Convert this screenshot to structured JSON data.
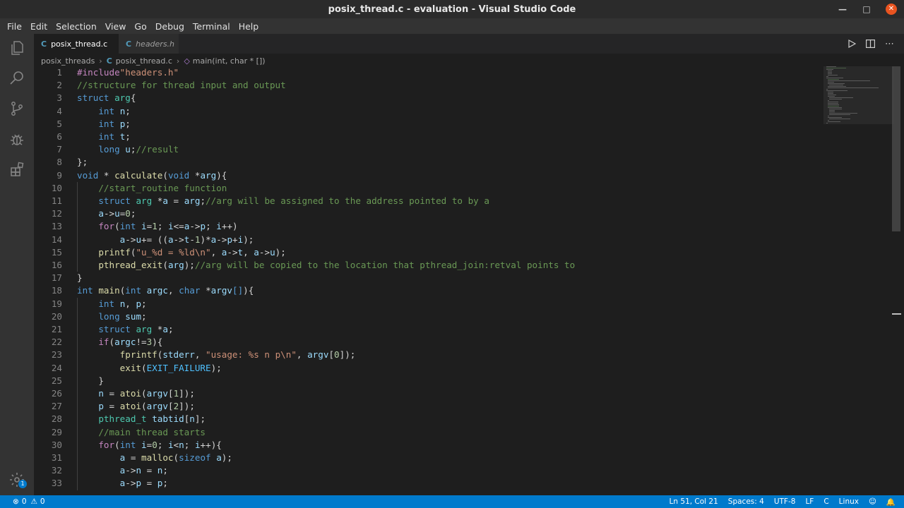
{
  "window": {
    "title": "posix_thread.c - evaluation - Visual Studio Code"
  },
  "menu": [
    "File",
    "Edit",
    "Selection",
    "View",
    "Go",
    "Debug",
    "Terminal",
    "Help"
  ],
  "tabs": [
    {
      "icon": "C",
      "label": "posix_thread.c",
      "active": true
    },
    {
      "icon": "C",
      "label": "headers.h",
      "active": false
    }
  ],
  "breadcrumb": {
    "folder": "posix_threads",
    "file": "posix_thread.c",
    "symbol": "main(int, char * [])"
  },
  "activity_icons": [
    "explorer-icon",
    "search-icon",
    "source-control-icon",
    "debug-icon",
    "extensions-icon",
    "settings-gear-icon"
  ],
  "settings_badge": "1",
  "colors": {
    "accent": "#007acc",
    "background": "#1e1e1e",
    "keyword": "#569cd6",
    "comment": "#6a9955",
    "string": "#ce9178",
    "function": "#dcdcaa",
    "type": "#4ec9b0"
  },
  "code_lines": [
    [
      [
        "ctl",
        "#include"
      ],
      [
        "str",
        "\"headers.h\""
      ]
    ],
    [
      [
        "com",
        "//structure for thread input and output"
      ]
    ],
    [
      [
        "kw",
        "struct"
      ],
      [
        "p",
        " "
      ],
      [
        "ty",
        "arg"
      ],
      [
        "p",
        "{"
      ]
    ],
    [
      [
        "p",
        "    "
      ],
      [
        "kw",
        "int"
      ],
      [
        "p",
        " "
      ],
      [
        "var",
        "n"
      ],
      [
        "p",
        ";"
      ]
    ],
    [
      [
        "p",
        "    "
      ],
      [
        "kw",
        "int"
      ],
      [
        "p",
        " "
      ],
      [
        "var",
        "p"
      ],
      [
        "p",
        ";"
      ]
    ],
    [
      [
        "p",
        "    "
      ],
      [
        "kw",
        "int"
      ],
      [
        "p",
        " "
      ],
      [
        "var",
        "t"
      ],
      [
        "p",
        ";"
      ]
    ],
    [
      [
        "p",
        "    "
      ],
      [
        "kw",
        "long"
      ],
      [
        "p",
        " "
      ],
      [
        "var",
        "u"
      ],
      [
        "p",
        ";"
      ],
      [
        "com",
        "//result"
      ]
    ],
    [
      [
        "p",
        "};"
      ]
    ],
    [
      [
        "kw",
        "void"
      ],
      [
        "p",
        " * "
      ],
      [
        "fn",
        "calculate"
      ],
      [
        "p",
        "("
      ],
      [
        "kw",
        "void"
      ],
      [
        "p",
        " *"
      ],
      [
        "var",
        "arg"
      ],
      [
        "p",
        "){"
      ]
    ],
    [
      [
        "p",
        "    "
      ],
      [
        "com",
        "//start_routine function"
      ]
    ],
    [
      [
        "p",
        "    "
      ],
      [
        "kw",
        "struct"
      ],
      [
        "p",
        " "
      ],
      [
        "ty",
        "arg"
      ],
      [
        "p",
        " *"
      ],
      [
        "var",
        "a"
      ],
      [
        "p",
        " = "
      ],
      [
        "var",
        "arg"
      ],
      [
        "p",
        ";"
      ],
      [
        "com",
        "//arg will be assigned to the address pointed to by a"
      ]
    ],
    [
      [
        "p",
        "    "
      ],
      [
        "var",
        "a"
      ],
      [
        "p",
        "->"
      ],
      [
        "var",
        "u"
      ],
      [
        "p",
        "="
      ],
      [
        "num",
        "0"
      ],
      [
        "p",
        ";"
      ]
    ],
    [
      [
        "p",
        "    "
      ],
      [
        "ctl",
        "for"
      ],
      [
        "p",
        "("
      ],
      [
        "kw",
        "int"
      ],
      [
        "p",
        " "
      ],
      [
        "var",
        "i"
      ],
      [
        "p",
        "="
      ],
      [
        "num",
        "1"
      ],
      [
        "p",
        "; "
      ],
      [
        "var",
        "i"
      ],
      [
        "p",
        "<="
      ],
      [
        "var",
        "a"
      ],
      [
        "p",
        "->"
      ],
      [
        "var",
        "p"
      ],
      [
        "p",
        "; "
      ],
      [
        "var",
        "i"
      ],
      [
        "p",
        "++)"
      ]
    ],
    [
      [
        "p",
        "        "
      ],
      [
        "var",
        "a"
      ],
      [
        "p",
        "->"
      ],
      [
        "var",
        "u"
      ],
      [
        "p",
        "+= (("
      ],
      [
        "var",
        "a"
      ],
      [
        "p",
        "->"
      ],
      [
        "var",
        "t"
      ],
      [
        "p",
        "-"
      ],
      [
        "num",
        "1"
      ],
      [
        "p",
        ")*"
      ],
      [
        "var",
        "a"
      ],
      [
        "p",
        "->"
      ],
      [
        "var",
        "p"
      ],
      [
        "p",
        "+"
      ],
      [
        "var",
        "i"
      ],
      [
        "p",
        ");"
      ]
    ],
    [
      [
        "p",
        "    "
      ],
      [
        "fn",
        "printf"
      ],
      [
        "p",
        "("
      ],
      [
        "str",
        "\"u_%d = %ld\\n\""
      ],
      [
        "p",
        ", "
      ],
      [
        "var",
        "a"
      ],
      [
        "p",
        "->"
      ],
      [
        "var",
        "t"
      ],
      [
        "p",
        ", "
      ],
      [
        "var",
        "a"
      ],
      [
        "p",
        "->"
      ],
      [
        "var",
        "u"
      ],
      [
        "p",
        ");"
      ]
    ],
    [
      [
        "p",
        "    "
      ],
      [
        "fn",
        "pthread_exit"
      ],
      [
        "p",
        "("
      ],
      [
        "var",
        "arg"
      ],
      [
        "p",
        ");"
      ],
      [
        "com",
        "//arg will be copied to the location that pthread_join:retval points to"
      ]
    ],
    [
      [
        "p",
        "}"
      ]
    ],
    [
      [
        "kw",
        "int"
      ],
      [
        "p",
        " "
      ],
      [
        "fn",
        "main"
      ],
      [
        "p",
        "("
      ],
      [
        "kw",
        "int"
      ],
      [
        "p",
        " "
      ],
      [
        "var",
        "argc"
      ],
      [
        "p",
        ", "
      ],
      [
        "kw",
        "char"
      ],
      [
        "p",
        " *"
      ],
      [
        "var",
        "argv"
      ],
      [
        "kw",
        "[]"
      ],
      [
        "p",
        "){"
      ]
    ],
    [
      [
        "p",
        "    "
      ],
      [
        "kw",
        "int"
      ],
      [
        "p",
        " "
      ],
      [
        "var",
        "n"
      ],
      [
        "p",
        ", "
      ],
      [
        "var",
        "p"
      ],
      [
        "p",
        ";"
      ]
    ],
    [
      [
        "p",
        "    "
      ],
      [
        "kw",
        "long"
      ],
      [
        "p",
        " "
      ],
      [
        "var",
        "sum"
      ],
      [
        "p",
        ";"
      ]
    ],
    [
      [
        "p",
        "    "
      ],
      [
        "kw",
        "struct"
      ],
      [
        "p",
        " "
      ],
      [
        "ty",
        "arg"
      ],
      [
        "p",
        " *"
      ],
      [
        "var",
        "a"
      ],
      [
        "p",
        ";"
      ]
    ],
    [
      [
        "p",
        "    "
      ],
      [
        "ctl",
        "if"
      ],
      [
        "p",
        "("
      ],
      [
        "var",
        "argc"
      ],
      [
        "p",
        "!="
      ],
      [
        "num",
        "3"
      ],
      [
        "p",
        "){"
      ]
    ],
    [
      [
        "p",
        "        "
      ],
      [
        "fn",
        "fprintf"
      ],
      [
        "p",
        "("
      ],
      [
        "var",
        "stderr"
      ],
      [
        "p",
        ", "
      ],
      [
        "str",
        "\"usage: %s n p\\n\""
      ],
      [
        "p",
        ", "
      ],
      [
        "var",
        "argv"
      ],
      [
        "p",
        "["
      ],
      [
        "num",
        "0"
      ],
      [
        "p",
        "]);"
      ]
    ],
    [
      [
        "p",
        "        "
      ],
      [
        "fn",
        "exit"
      ],
      [
        "p",
        "("
      ],
      [
        "mac",
        "EXIT_FAILURE"
      ],
      [
        "p",
        ");"
      ]
    ],
    [
      [
        "p",
        "    }"
      ]
    ],
    [
      [
        "p",
        "    "
      ],
      [
        "var",
        "n"
      ],
      [
        "p",
        " = "
      ],
      [
        "fn",
        "atoi"
      ],
      [
        "p",
        "("
      ],
      [
        "var",
        "argv"
      ],
      [
        "p",
        "["
      ],
      [
        "num",
        "1"
      ],
      [
        "p",
        "]);"
      ]
    ],
    [
      [
        "p",
        "    "
      ],
      [
        "var",
        "p"
      ],
      [
        "p",
        " = "
      ],
      [
        "fn",
        "atoi"
      ],
      [
        "p",
        "("
      ],
      [
        "var",
        "argv"
      ],
      [
        "p",
        "["
      ],
      [
        "num",
        "2"
      ],
      [
        "p",
        "]);"
      ]
    ],
    [
      [
        "p",
        "    "
      ],
      [
        "ty",
        "pthread_t"
      ],
      [
        "p",
        " "
      ],
      [
        "var",
        "tabtid"
      ],
      [
        "p",
        "["
      ],
      [
        "var",
        "n"
      ],
      [
        "p",
        "];"
      ]
    ],
    [
      [
        "p",
        "    "
      ],
      [
        "com",
        "//main thread starts"
      ]
    ],
    [
      [
        "p",
        "    "
      ],
      [
        "ctl",
        "for"
      ],
      [
        "p",
        "("
      ],
      [
        "kw",
        "int"
      ],
      [
        "p",
        " "
      ],
      [
        "var",
        "i"
      ],
      [
        "p",
        "="
      ],
      [
        "num",
        "0"
      ],
      [
        "p",
        "; "
      ],
      [
        "var",
        "i"
      ],
      [
        "p",
        "<"
      ],
      [
        "var",
        "n"
      ],
      [
        "p",
        "; "
      ],
      [
        "var",
        "i"
      ],
      [
        "p",
        "++){"
      ]
    ],
    [
      [
        "p",
        "        "
      ],
      [
        "var",
        "a"
      ],
      [
        "p",
        " = "
      ],
      [
        "fn",
        "malloc"
      ],
      [
        "p",
        "("
      ],
      [
        "kw",
        "sizeof"
      ],
      [
        "p",
        " "
      ],
      [
        "var",
        "a"
      ],
      [
        "p",
        ");"
      ]
    ],
    [
      [
        "p",
        "        "
      ],
      [
        "var",
        "a"
      ],
      [
        "p",
        "->"
      ],
      [
        "var",
        "n"
      ],
      [
        "p",
        " = "
      ],
      [
        "var",
        "n"
      ],
      [
        "p",
        ";"
      ]
    ],
    [
      [
        "p",
        "        "
      ],
      [
        "var",
        "a"
      ],
      [
        "p",
        "->"
      ],
      [
        "var",
        "p"
      ],
      [
        "p",
        " = "
      ],
      [
        "var",
        "p"
      ],
      [
        "p",
        ";"
      ]
    ]
  ],
  "status": {
    "errors": "0",
    "warnings": "0",
    "cursor": "Ln 51, Col 21",
    "spaces": "Spaces: 4",
    "encoding": "UTF-8",
    "eol": "LF",
    "language": "C",
    "platform": "Linux"
  }
}
